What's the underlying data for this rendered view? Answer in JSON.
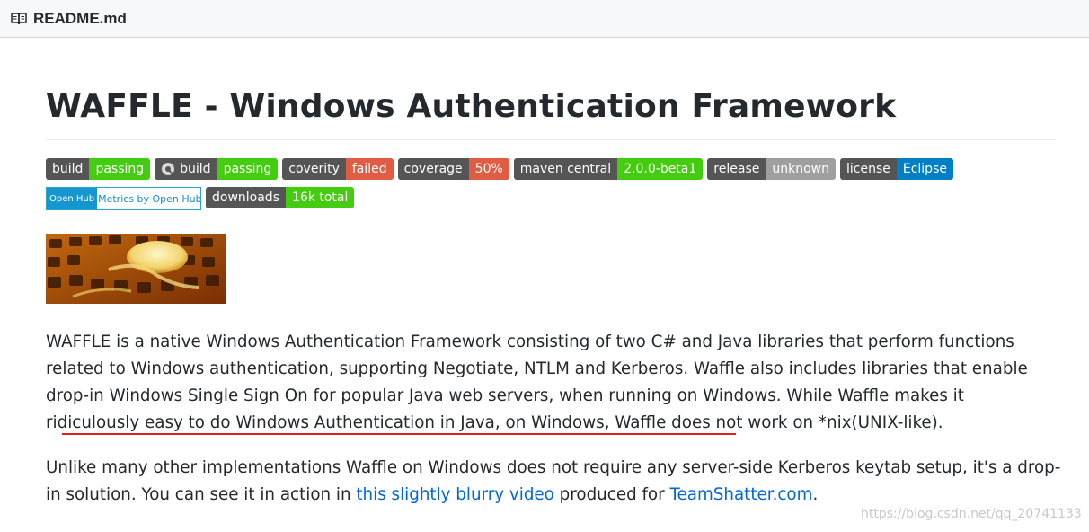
{
  "file_header": {
    "filename": "README.md",
    "icon": "book-icon"
  },
  "title": "WAFFLE - Windows Authentication Framework",
  "badges_row1": [
    {
      "label": "build",
      "value": "passing",
      "color": "#4c1",
      "icon": ""
    },
    {
      "label": "build",
      "value": "passing",
      "color": "#4c1",
      "icon": "appveyor-icon"
    },
    {
      "label": "coverity",
      "value": "failed",
      "color": "#e05d44",
      "icon": ""
    },
    {
      "label": "coverage",
      "value": "50%",
      "color": "#e05d44",
      "icon": ""
    },
    {
      "label": "maven central",
      "value": "2.0.0-beta1",
      "color": "#4c1",
      "icon": ""
    },
    {
      "label": "release",
      "value": "unknown",
      "color": "#9f9f9f",
      "icon": ""
    },
    {
      "label": "license",
      "value": "Eclipse",
      "color": "#007ec6",
      "icon": ""
    }
  ],
  "openhub_badge": {
    "left": "Open Hub",
    "right": "Metrics by Open Hub"
  },
  "downloads_badge": {
    "label": "downloads",
    "value": "16k total",
    "color": "#4c1"
  },
  "paragraph1": "WAFFLE is a native Windows Authentication Framework consisting of two C# and Java libraries that perform functions related to Windows authentication, supporting Negotiate, NTLM and Kerberos. Waffle also includes libraries that enable drop-in Windows Single Sign On for popular Java web servers, when running on Windows. While Waffle makes it ridiculously easy to do Windows Authentication in Java, on Windows, Waffle does not work on *nix(UNIX-like).",
  "paragraph2": {
    "before": "Unlike many other implementations Waffle on Windows does not require any server-side Kerberos keytab setup, it's a drop-in solution. You can see it in action in ",
    "link1": "this slightly blurry video",
    "middle": " produced for ",
    "link2": "TeamShatter.com",
    "after": "."
  },
  "watermark": "https://blog.csdn.net/qq_20741133",
  "colors": {
    "badge_label_bg": "#555555",
    "link": "#0366d6",
    "annotation_underline": "#e0201c"
  }
}
